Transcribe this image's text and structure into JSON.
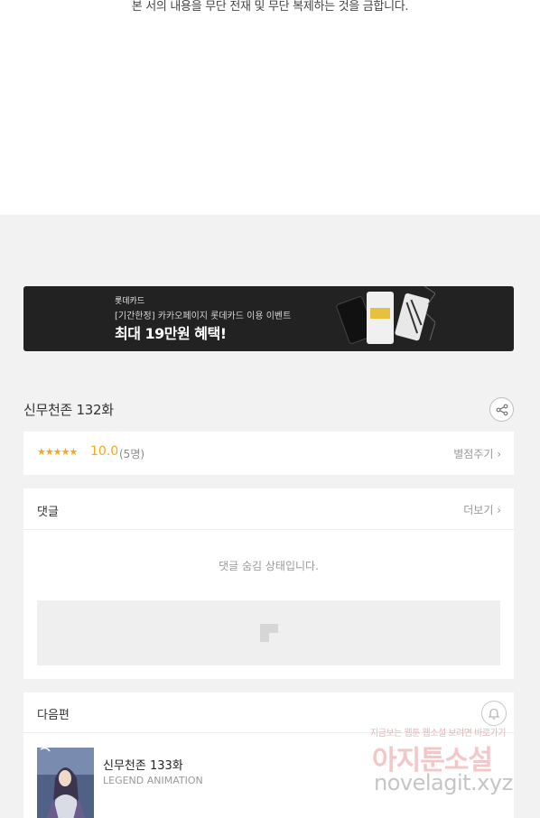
{
  "notice": {
    "text": "본 서의 내용을 무단 전재 및 무단 복제하는 것을 금합니다."
  },
  "banner": {
    "brand": "롯데카드",
    "subtitle": "[기간한정] 카카오페이지 롯데카드 이용 이벤트",
    "headline": "최대 19만원 혜택!"
  },
  "episode": {
    "title": "신무천존 132화"
  },
  "rating": {
    "stars": "★★★★★",
    "score": "10.0",
    "count": "(5명)",
    "rate_link": "별점주기 ›"
  },
  "comments": {
    "title": "댓글",
    "more_link": "더보기 ›",
    "hidden_message": "댓글 숨김 상태입니다."
  },
  "next": {
    "title": "다음편",
    "episode_title": "신무천존 133화",
    "studio": "LEGEND ANIMATION"
  },
  "watermark": {
    "top": "지금보는 웹툰 웹소설 보려면 바로가기",
    "main": "아지툰소설",
    "url": "novelagit.xyz"
  },
  "colors": {
    "accent": "#f5a623",
    "banner_bg": "#232222",
    "page_bg": "#f2f2f2"
  }
}
